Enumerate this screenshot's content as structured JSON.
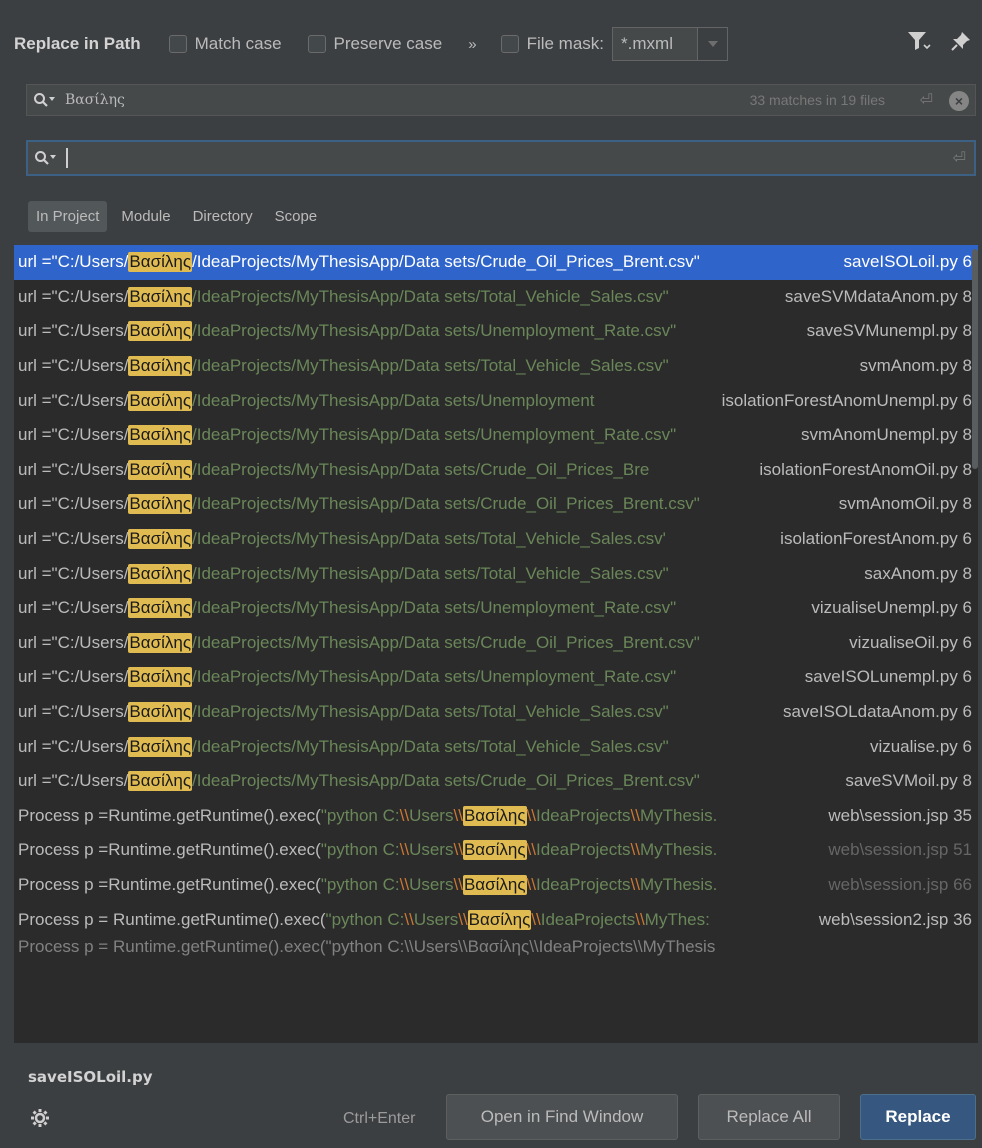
{
  "header": {
    "title": "Replace in Path",
    "match_case": "Match case",
    "preserve_case": "Preserve case",
    "more": "»",
    "file_mask_label": "File mask:",
    "file_mask_value": "*.mxml"
  },
  "search": {
    "query": "Βασίλης",
    "matches": "33 matches in 19 files"
  },
  "replace": {
    "value": ""
  },
  "scopes": [
    "In Project",
    "Module",
    "Directory",
    "Scope"
  ],
  "results": [
    {
      "prefix": "url =\"C:/Users/",
      "hit": "Βασίλης",
      "rest": "/IdeaProjects/MyThesisApp/Data sets/Crude_Oil_Prices_Brent.csv\"",
      "file": "saveISOLoil.py 6"
    },
    {
      "prefix": "url =\"C:/Users/",
      "hit": "Βασίλης",
      "rest": "/IdeaProjects/MyThesisApp/Data sets/Total_Vehicle_Sales.csv\"",
      "file": "saveSVMdataAnom.py 8"
    },
    {
      "prefix": "url =\"C:/Users/",
      "hit": "Βασίλης",
      "rest": "/IdeaProjects/MyThesisApp/Data sets/Unemployment_Rate.csv\"",
      "file": "saveSVMunempl.py 8"
    },
    {
      "prefix": "url =\"C:/Users/",
      "hit": "Βασίλης",
      "rest": "/IdeaProjects/MyThesisApp/Data sets/Total_Vehicle_Sales.csv\"",
      "file": "svmAnom.py 8"
    },
    {
      "prefix": "url =\"C:/Users/",
      "hit": "Βασίλης",
      "rest": "/IdeaProjects/MyThesisApp/Data sets/Unemployment",
      "file": "isolationForestAnomUnempl.py 6"
    },
    {
      "prefix": "url =\"C:/Users/",
      "hit": "Βασίλης",
      "rest": "/IdeaProjects/MyThesisApp/Data sets/Unemployment_Rate.csv\"",
      "file": "svmAnomUnempl.py 8"
    },
    {
      "prefix": "url =\"C:/Users/",
      "hit": "Βασίλης",
      "rest": "/IdeaProjects/MyThesisApp/Data sets/Crude_Oil_Prices_Bre",
      "file": "isolationForestAnomOil.py 8"
    },
    {
      "prefix": "url =\"C:/Users/",
      "hit": "Βασίλης",
      "rest": "/IdeaProjects/MyThesisApp/Data sets/Crude_Oil_Prices_Brent.csv\"",
      "file": "svmAnomOil.py 8"
    },
    {
      "prefix": "url =\"C:/Users/",
      "hit": "Βασίλης",
      "rest": "/IdeaProjects/MyThesisApp/Data sets/Total_Vehicle_Sales.csv'",
      "file": "isolationForestAnom.py 6"
    },
    {
      "prefix": "url =\"C:/Users/",
      "hit": "Βασίλης",
      "rest": "/IdeaProjects/MyThesisApp/Data sets/Total_Vehicle_Sales.csv\"",
      "file": "saxAnom.py 8"
    },
    {
      "prefix": "url =\"C:/Users/",
      "hit": "Βασίλης",
      "rest": "/IdeaProjects/MyThesisApp/Data sets/Unemployment_Rate.csv\"",
      "file": "vizualiseUnempl.py 6"
    },
    {
      "prefix": "url =\"C:/Users/",
      "hit": "Βασίλης",
      "rest": "/IdeaProjects/MyThesisApp/Data sets/Crude_Oil_Prices_Brent.csv\"",
      "file": "vizualiseOil.py 6"
    },
    {
      "prefix": "url =\"C:/Users/",
      "hit": "Βασίλης",
      "rest": "/IdeaProjects/MyThesisApp/Data sets/Unemployment_Rate.csv\"",
      "file": "saveISOLunempl.py 6"
    },
    {
      "prefix": "url =\"C:/Users/",
      "hit": "Βασίλης",
      "rest": "/IdeaProjects/MyThesisApp/Data sets/Total_Vehicle_Sales.csv\"",
      "file": "saveISOLdataAnom.py 6"
    },
    {
      "prefix": "url =\"C:/Users/",
      "hit": "Βασίλης",
      "rest": "/IdeaProjects/MyThesisApp/Data sets/Total_Vehicle_Sales.csv\"",
      "file": "vizualise.py 6"
    },
    {
      "prefix": "url =\"C:/Users/",
      "hit": "Βασίλης",
      "rest": "/IdeaProjects/MyThesisApp/Data sets/Crude_Oil_Prices_Brent.csv\"",
      "file": "saveSVMoil.py 8"
    }
  ],
  "java_results": [
    {
      "prefix": "Process p =Runtime.getRuntime().exec(",
      "s1": "\"python C:",
      "e1": "\\\\",
      "s2": "Users",
      "e2": "\\\\",
      "hit": "Βασίλης",
      "e3": "\\\\",
      "s3": "IdeaProjects",
      "e4": "\\\\",
      "s4": "MyThesis.",
      "file": "web\\session.jsp 35",
      "dim": false
    },
    {
      "prefix": "Process p =Runtime.getRuntime().exec(",
      "s1": "\"python C:",
      "e1": "\\\\",
      "s2": "Users",
      "e2": "\\\\",
      "hit": "Βασίλης",
      "e3": "\\\\",
      "s3": "IdeaProjects",
      "e4": "\\\\",
      "s4": "MyThesis.",
      "file": "web\\session.jsp 51",
      "dim": true
    },
    {
      "prefix": "Process p =Runtime.getRuntime().exec(",
      "s1": "\"python C:",
      "e1": "\\\\",
      "s2": "Users",
      "e2": "\\\\",
      "hit": "Βασίλης",
      "e3": "\\\\",
      "s3": "IdeaProjects",
      "e4": "\\\\",
      "s4": "MyThesis.",
      "file": "web\\session.jsp 66",
      "dim": true
    },
    {
      "prefix": "Process p  = Runtime.getRuntime().exec(",
      "s1": "\"python C:",
      "e1": "\\\\",
      "s2": "Users",
      "e2": "\\\\",
      "hit": "Βασίλης",
      "e3": "\\\\",
      "s3": "IdeaProjects",
      "e4": "\\\\",
      "s4": "MyThes:",
      "file": "web\\session2.jsp 36",
      "dim": false
    }
  ],
  "footer": {
    "selected_file": "saveISOLoil.py",
    "shortcut": "Ctrl+Enter",
    "open_in_find_window": "Open in Find Window",
    "replace_all": "Replace All",
    "replace": "Replace"
  },
  "colors": {
    "background": "#3c3f41",
    "results_bg": "#2b2b2b",
    "selection": "#2f65ca",
    "highlight": "#e0bb52",
    "string": "#6a8759",
    "escape": "#cc7832",
    "primary_button": "#365880"
  },
  "icons": [
    "search-icon",
    "filter-icon",
    "pin-icon",
    "enter-icon",
    "clear-icon",
    "gear-icon"
  ]
}
